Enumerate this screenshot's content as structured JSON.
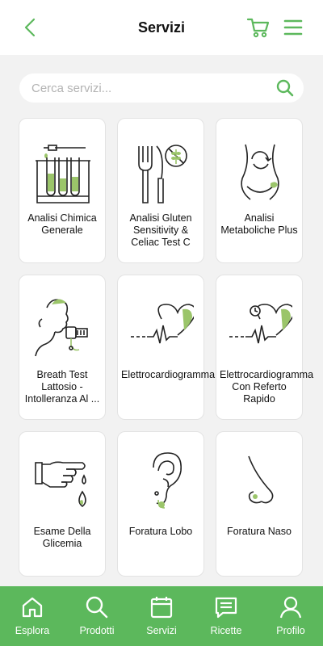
{
  "header": {
    "title": "Servizi"
  },
  "search": {
    "placeholder": "Cerca servizi..."
  },
  "services": [
    {
      "label": "Analisi Chimica Generale",
      "icon": "test-tubes-icon"
    },
    {
      "label": "Analisi Gluten Sensitivity & Celiac Test C",
      "icon": "gluten-fork-icon"
    },
    {
      "label": "Analisi Metaboliche Plus",
      "icon": "body-metabolism-icon"
    },
    {
      "label": "Breath Test Lattosio - Intolleranza Al ...",
      "icon": "breath-test-icon"
    },
    {
      "label": "Elettrocardiogramma",
      "icon": "heart-ecg-icon"
    },
    {
      "label": "Elettrocardiogramma Con Referto Rapido",
      "icon": "heart-ecg-clock-icon"
    },
    {
      "label": "Esame Della Glicemia",
      "icon": "glycemia-finger-icon"
    },
    {
      "label": "Foratura Lobo",
      "icon": "ear-icon"
    },
    {
      "label": "Foratura Naso",
      "icon": "nose-icon"
    }
  ],
  "bottom_nav": [
    {
      "label": "Esplora",
      "icon": "home-icon"
    },
    {
      "label": "Prodotti",
      "icon": "search-icon"
    },
    {
      "label": "Servizi",
      "icon": "calendar-icon"
    },
    {
      "label": "Ricette",
      "icon": "prescription-icon"
    },
    {
      "label": "Profilo",
      "icon": "user-icon"
    }
  ],
  "colors": {
    "accent": "#5cb85c",
    "background": "#f2f2f2"
  }
}
